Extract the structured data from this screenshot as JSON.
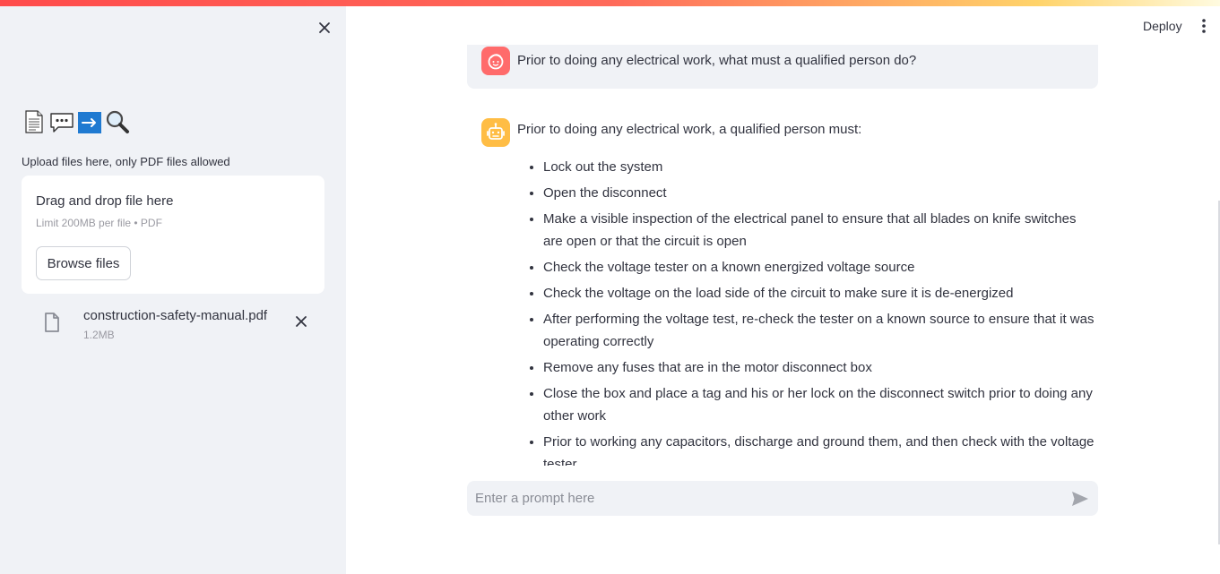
{
  "sidebar": {
    "emoji_icons": [
      "page-facing-up-icon",
      "speech-balloon-icon",
      "right-arrow-icon",
      "magnifying-glass-icon"
    ],
    "upload_label": "Upload files here, only PDF files allowed",
    "dropzone": {
      "title": "Drag and drop file here",
      "limit": "Limit 200MB per file • PDF",
      "browse_label": "Browse files"
    },
    "file": {
      "name": "construction-safety-manual.pdf",
      "size": "1.2MB"
    }
  },
  "header": {
    "deploy_label": "Deploy"
  },
  "chat": {
    "user_message": "Prior to doing any electrical work, what must a qualified person do?",
    "assistant_intro": "Prior to doing any electrical work, a qualified person must:",
    "assistant_items": [
      "Lock out the system",
      "Open the disconnect",
      "Make a visible inspection of the electrical panel to ensure that all blades on knife switches are open or that the circuit is open",
      "Check the voltage tester on a known energized voltage source",
      "Check the voltage on the load side of the circuit to make sure it is de-energized",
      "After performing the voltage test, re-check the tester on a known source to ensure that it was operating correctly",
      "Remove any fuses that are in the motor disconnect box",
      "Close the box and place a tag and his or her lock on the disconnect switch prior to doing any other work",
      "Prior to working any capacitors, discharge and ground them, and then check with the voltage tester"
    ]
  },
  "prompt": {
    "placeholder": "Enter a prompt here",
    "value": ""
  },
  "colors": {
    "sidebar_bg": "#f0f2f6",
    "user_avatar": "#ff6b6b",
    "assistant_avatar": "#ffbd45",
    "accent": "#ff4b4b"
  }
}
